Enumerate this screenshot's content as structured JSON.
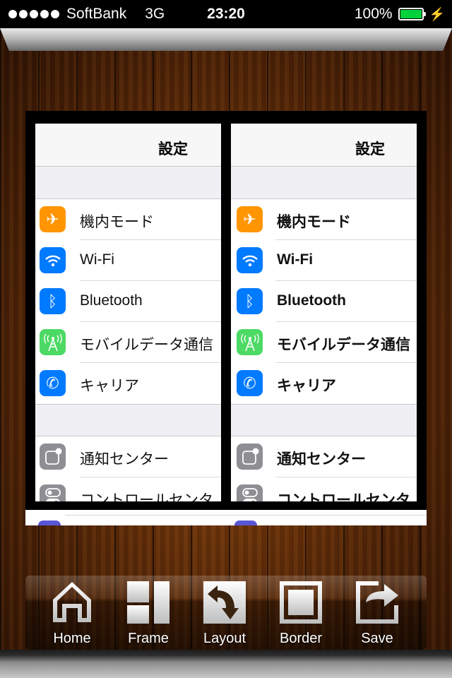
{
  "status_bar": {
    "signal_dots": 5,
    "carrier": "SoftBank",
    "network": "3G",
    "time": "23:20",
    "battery_percent": "100%",
    "battery_level": 1.0,
    "charging": true
  },
  "panels": [
    {
      "title": "設定",
      "style": "regular",
      "group1": [
        {
          "label": "機内モード",
          "icon": "airplane-icon",
          "color": "#ff9500"
        },
        {
          "label": "Wi-Fi",
          "icon": "wifi-icon",
          "color": "#007aff"
        },
        {
          "label": "Bluetooth",
          "icon": "bluetooth-icon",
          "color": "#007aff"
        },
        {
          "label": "モバイルデータ通信",
          "icon": "cellular-icon",
          "color": "#4cd964"
        },
        {
          "label": "キャリア",
          "icon": "phone-icon",
          "color": "#007aff"
        }
      ],
      "group2": [
        {
          "label": "通知センター",
          "icon": "notification-center-icon",
          "color": "#8e8e93"
        },
        {
          "label": "コントロールセンタ",
          "icon": "control-center-icon",
          "color": "#8e8e93"
        }
      ]
    },
    {
      "title": "設定",
      "style": "bold",
      "group1": [
        {
          "label": "機内モード",
          "icon": "airplane-icon",
          "color": "#ff9500"
        },
        {
          "label": "Wi-Fi",
          "icon": "wifi-icon",
          "color": "#007aff"
        },
        {
          "label": "Bluetooth",
          "icon": "bluetooth-icon",
          "color": "#007aff"
        },
        {
          "label": "モバイルデータ通信",
          "icon": "cellular-icon",
          "color": "#4cd964"
        },
        {
          "label": "キャリア",
          "icon": "phone-icon",
          "color": "#007aff"
        }
      ],
      "group2": [
        {
          "label": "通知センター",
          "icon": "notification-center-icon",
          "color": "#8e8e93"
        },
        {
          "label": "コントロールセンタ",
          "icon": "control-center-icon",
          "color": "#8e8e93"
        }
      ]
    }
  ],
  "toolbar": {
    "items": [
      {
        "label": "Home",
        "icon": "home-icon"
      },
      {
        "label": "Frame",
        "icon": "frame-icon"
      },
      {
        "label": "Layout",
        "icon": "layout-icon"
      },
      {
        "label": "Border",
        "icon": "border-icon"
      },
      {
        "label": "Save",
        "icon": "save-share-icon"
      }
    ]
  }
}
